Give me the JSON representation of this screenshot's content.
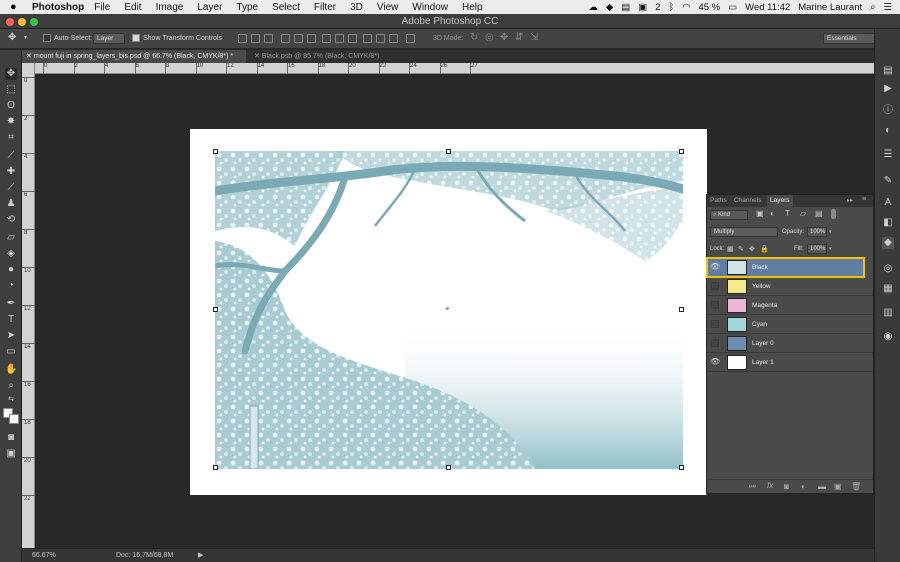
{
  "menubar": {
    "app_name": "Photoshop",
    "items": [
      "File",
      "Edit",
      "Image",
      "Layer",
      "Type",
      "Select",
      "Filter",
      "3D",
      "View",
      "Window",
      "Help"
    ],
    "status_badge": "2",
    "battery": "45 %",
    "clock": "Wed 11:42",
    "user": "Marine Laurant"
  },
  "window": {
    "title": "Adobe Photoshop CC"
  },
  "options": {
    "auto_select_label": "Auto-Select:",
    "auto_select_value": "Layer",
    "transform_label": "Show Transform Controls",
    "mode_3d_label": "3D Mode:",
    "workspace": "Essentials"
  },
  "tabs": [
    {
      "label": "mount fuji in spring_layers_bis.psd @ 66.7% (Black, CMYK/8*) *",
      "active": true
    },
    {
      "label": "Black.psb @ 85.7% (Black, CMYK/8*)",
      "active": false
    }
  ],
  "ruler": {
    "h": [
      "0",
      "2",
      "4",
      "6",
      "8",
      "10",
      "12",
      "14",
      "16",
      "18",
      "20",
      "22",
      "24",
      "26",
      "27"
    ],
    "v": [
      "0",
      "2",
      "4",
      "6",
      "8",
      "10",
      "12",
      "14",
      "16",
      "18",
      "20",
      "22"
    ]
  },
  "status": {
    "zoom": "66.67%",
    "doc": "Doc: 16,7M/68,8M"
  },
  "layers_panel": {
    "tabs": [
      "Paths",
      "Channels",
      "Layers"
    ],
    "kind": "Kind",
    "blend_mode": "Multiply",
    "opacity_label": "Opacity:",
    "opacity_value": "100%",
    "lock_label": "Lock:",
    "fill_label": "Fill:",
    "fill_value": "100%",
    "layers": [
      {
        "name": "Black",
        "visible": true,
        "selected": true,
        "color": "#cfe3e8"
      },
      {
        "name": "Yellow",
        "visible": false,
        "selected": false,
        "color": "#f6ea8a"
      },
      {
        "name": "Magenta",
        "visible": false,
        "selected": false,
        "color": "#efb5d6"
      },
      {
        "name": "Cyan",
        "visible": false,
        "selected": false,
        "color": "#9fd6dc"
      },
      {
        "name": "Layer 0",
        "visible": false,
        "selected": false,
        "color": "#6f8db2"
      },
      {
        "name": "Layer 1",
        "visible": true,
        "selected": false,
        "color": "#ffffff"
      }
    ]
  },
  "colors": {
    "highlight": "#f2c200",
    "selected_row": "#5f7ea1",
    "artwork_tint": "#8bbcc7"
  }
}
